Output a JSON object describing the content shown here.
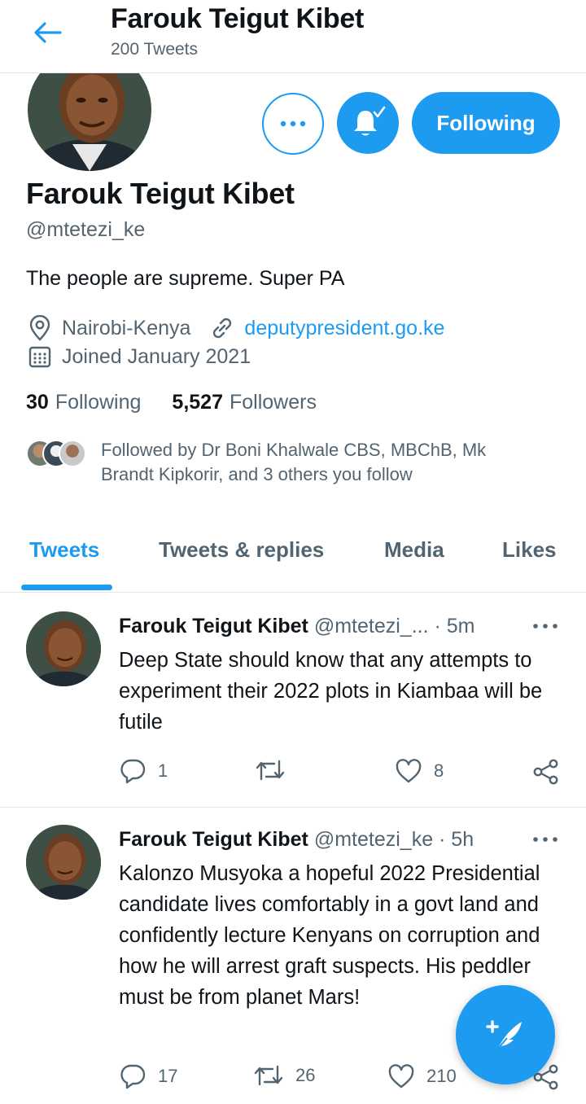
{
  "header": {
    "title": "Farouk Teigut Kibet",
    "subtitle": "200 Tweets"
  },
  "profile": {
    "name": "Farouk Teigut Kibet",
    "handle": "@mtetezi_ke",
    "bio": "The people are supreme. Super PA",
    "location": "Nairobi-Kenya",
    "website": "deputypresident.go.ke",
    "joined": "Joined January 2021",
    "following_count": "30",
    "following_label": "Following",
    "followers_count": "5,527",
    "followers_label": "Followers",
    "followed_by": "Followed by Dr Boni Khalwale CBS, MBChB, Mk Brandt Kipkorir, and 3 others you follow",
    "follow_button_label": "Following"
  },
  "tabs": [
    {
      "label": "Tweets",
      "active": true
    },
    {
      "label": "Tweets & replies",
      "active": false
    },
    {
      "label": "Media",
      "active": false
    },
    {
      "label": "Likes",
      "active": false
    }
  ],
  "tweets": [
    {
      "name": "Farouk Teigut Kibet",
      "handle_time": "@mtetezi_... · 5m",
      "text": "Deep State should know that any attempts to experiment their 2022 plots in Kiambaa will be futile",
      "replies": "1",
      "retweets": "",
      "likes": "8"
    },
    {
      "name": "Farouk Teigut Kibet",
      "handle_time": "@mtetezi_ke · 5h",
      "text": "Kalonzo Musyoka a hopeful 2022 Presidential candidate lives comfortably in a govt land and confidently lecture Kenyans on corruption and how he will arrest graft suspects. His peddler must be from planet Mars!",
      "replies": "17",
      "retweets": "26",
      "likes": "210"
    }
  ],
  "colors": {
    "accent": "#1d9bf0",
    "text_primary": "#0f1419",
    "text_secondary": "#536471",
    "divider": "#e1e6ea"
  },
  "icons": {
    "back": "arrow-left-icon",
    "more": "more-dots-icon",
    "notifications": "bell-check-icon",
    "location": "location-pin-icon",
    "link": "link-icon",
    "joined": "calendar-icon",
    "reply": "reply-icon",
    "retweet": "retweet-icon",
    "like": "heart-icon",
    "share": "share-icon",
    "compose": "compose-feather-icon"
  }
}
